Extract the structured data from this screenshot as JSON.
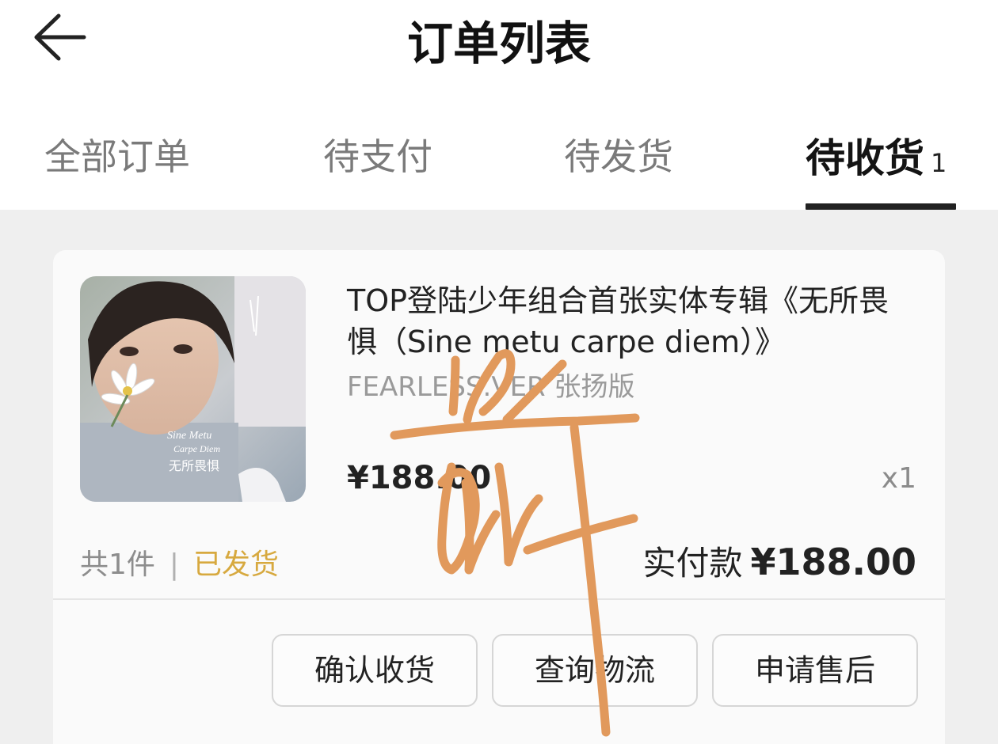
{
  "header": {
    "title": "订单列表",
    "back_icon": "arrow-left-icon"
  },
  "tabs": [
    {
      "label": "全部订单",
      "active": false
    },
    {
      "label": "待支付",
      "active": false
    },
    {
      "label": "待发货",
      "active": false
    },
    {
      "label": "待收货",
      "count": "1",
      "active": true
    }
  ],
  "order": {
    "product_title": "TOP登陆少年组合首张实体专辑《无所畏惧（Sine metu carpe diem）》",
    "variant": "FEARLESS.VER 张扬版",
    "price": "¥188.00",
    "quantity": "x1",
    "item_count": "共1件",
    "separator": "|",
    "status": "已发货",
    "paid_label": "实付款",
    "paid_amount": "¥188.00",
    "album_cover_text": "Sine Metu Carpe Diem",
    "album_cover_cn": "无所畏惧"
  },
  "actions": {
    "confirm": "确认收货",
    "logistics": "查询物流",
    "aftersale": "申请售后"
  },
  "colors": {
    "status": "#d7a93f",
    "scribble": "#e1995c",
    "accent": "#222222"
  }
}
